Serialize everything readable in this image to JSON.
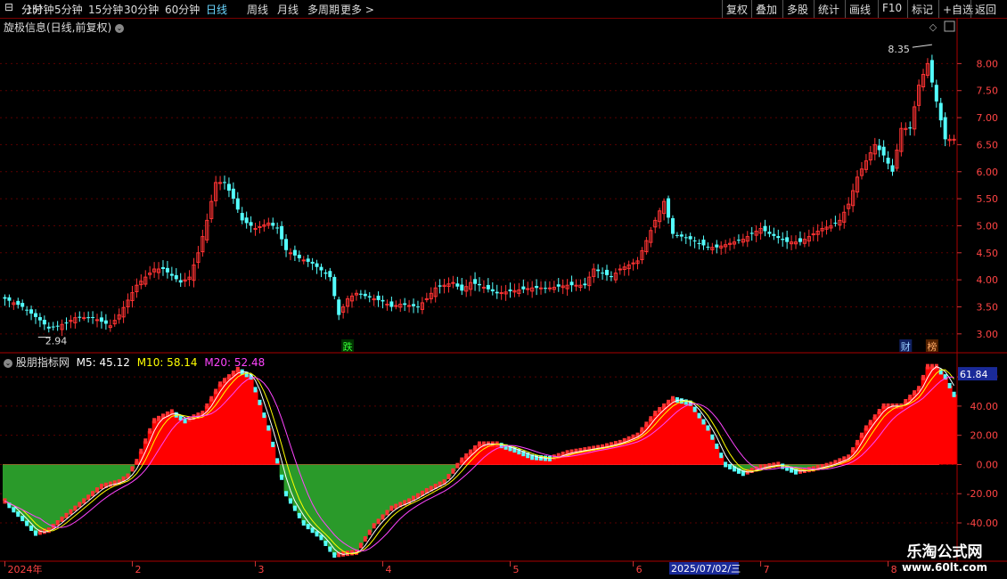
{
  "toolbar": {
    "left": [
      {
        "label": "分时",
        "active": false
      },
      {
        "label": "1分钟",
        "active": false
      },
      {
        "label": "5分钟",
        "active": false
      },
      {
        "label": "15分钟",
        "active": false
      },
      {
        "label": "30分钟",
        "active": false
      },
      {
        "label": "60分钟",
        "active": false
      },
      {
        "label": "日线",
        "active": true
      },
      {
        "label": "周线",
        "active": false
      },
      {
        "label": "月线",
        "active": false
      },
      {
        "label": "多周期",
        "active": false
      },
      {
        "label": "更多 >",
        "active": false
      }
    ],
    "right": [
      "复权",
      "叠加",
      "多股",
      "统计",
      "画线",
      "F10",
      "标记",
      "+自选",
      "返回"
    ]
  },
  "price_panel": {
    "title": "旋极信息(日线,前复权)"
  },
  "indicator_panel": {
    "name": "股朋指标网",
    "m5_label": "M5: 45.12",
    "m10_label": "M10: 58.14",
    "m20_label": "M20: 52.48",
    "current_value": "61.84"
  },
  "markers": {
    "die": "跌",
    "cai": "财",
    "bang": "榜"
  },
  "annotations": {
    "high": "8.35",
    "low": "2.94"
  },
  "date_tooltip": "2025/07/02/三",
  "watermark": {
    "line1": "乐淘公式网",
    "line2": "www.60lt.com"
  },
  "colors": {
    "up": "#ff3333",
    "down": "#54ffff",
    "zero": "#00aa00",
    "m5": "#ffffff",
    "m10": "#ffff00",
    "m20": "#ff44ff",
    "area_pos": "#ff0000",
    "area_neg": "#2a9a2a"
  },
  "chart_data": [
    {
      "type": "candlestick",
      "title": "旋极信息(日线,前复权)",
      "y_ticks": [
        3.0,
        3.5,
        4.0,
        4.5,
        5.0,
        5.5,
        6.0,
        6.5,
        7.0,
        7.5,
        8.0
      ],
      "ylim": [
        2.75,
        8.55
      ],
      "x_labels": [
        "2024年",
        "2",
        "3",
        "4",
        "5",
        "6",
        "7",
        "8"
      ],
      "close_path": [
        [
          0,
          3.65
        ],
        [
          4,
          3.5
        ],
        [
          8,
          3.25
        ],
        [
          10,
          3.1
        ],
        [
          12,
          3.15
        ],
        [
          14,
          3.2
        ],
        [
          16,
          3.3
        ],
        [
          20,
          3.3
        ],
        [
          24,
          3.15
        ],
        [
          26,
          3.35
        ],
        [
          30,
          3.9
        ],
        [
          34,
          4.2
        ],
        [
          36,
          4.2
        ],
        [
          40,
          3.95
        ],
        [
          42,
          4.05
        ],
        [
          44,
          4.5
        ],
        [
          46,
          5.1
        ],
        [
          48,
          5.8
        ],
        [
          50,
          5.8
        ],
        [
          52,
          5.5
        ],
        [
          54,
          5.1
        ],
        [
          57,
          4.95
        ],
        [
          60,
          5.05
        ],
        [
          62,
          4.95
        ],
        [
          64,
          4.55
        ],
        [
          67,
          4.4
        ],
        [
          70,
          4.3
        ],
        [
          74,
          4.05
        ],
        [
          76,
          3.35
        ],
        [
          78,
          3.65
        ],
        [
          80,
          3.75
        ],
        [
          82,
          3.7
        ],
        [
          86,
          3.6
        ],
        [
          88,
          3.5
        ],
        [
          90,
          3.55
        ],
        [
          94,
          3.5
        ],
        [
          96,
          3.65
        ],
        [
          98,
          3.85
        ],
        [
          102,
          3.95
        ],
        [
          104,
          3.8
        ],
        [
          106,
          3.95
        ],
        [
          108,
          3.9
        ],
        [
          112,
          3.75
        ],
        [
          116,
          3.8
        ],
        [
          120,
          3.85
        ],
        [
          124,
          3.85
        ],
        [
          128,
          3.9
        ],
        [
          132,
          3.9
        ],
        [
          134,
          4.2
        ],
        [
          138,
          4.05
        ],
        [
          140,
          4.2
        ],
        [
          144,
          4.35
        ],
        [
          148,
          5.1
        ],
        [
          150,
          5.45
        ],
        [
          152,
          4.85
        ],
        [
          156,
          4.75
        ],
        [
          160,
          4.6
        ],
        [
          162,
          4.6
        ],
        [
          164,
          4.65
        ],
        [
          168,
          4.75
        ],
        [
          170,
          4.85
        ],
        [
          172,
          4.95
        ],
        [
          174,
          4.85
        ],
        [
          178,
          4.7
        ],
        [
          181,
          4.7
        ],
        [
          183,
          4.8
        ],
        [
          186,
          4.95
        ],
        [
          188,
          5.0
        ],
        [
          190,
          5.1
        ],
        [
          192,
          5.4
        ],
        [
          194,
          5.9
        ],
        [
          196,
          6.2
        ],
        [
          198,
          6.5
        ],
        [
          200,
          6.3
        ],
        [
          202,
          6.0
        ],
        [
          204,
          6.8
        ],
        [
          206,
          6.8
        ],
        [
          208,
          7.6
        ],
        [
          210,
          8.0
        ],
        [
          212,
          7.3
        ],
        [
          214,
          6.6
        ],
        [
          216,
          6.6
        ]
      ],
      "annotations": [
        {
          "text": "8.35",
          "x": 211,
          "y": 8.35
        },
        {
          "text": "2.94",
          "x": 10,
          "y": 2.94
        }
      ]
    },
    {
      "type": "area",
      "title": "股朋指标网",
      "y_ticks": [
        -40,
        -20,
        0,
        20,
        40,
        60
      ],
      "ylim": [
        -65,
        68
      ],
      "main_path": [
        [
          0,
          -25
        ],
        [
          4,
          -37
        ],
        [
          7,
          -47
        ],
        [
          10,
          -45
        ],
        [
          14,
          -35
        ],
        [
          18,
          -25
        ],
        [
          22,
          -15
        ],
        [
          26,
          -12
        ],
        [
          28,
          -8
        ],
        [
          30,
          2
        ],
        [
          34,
          30
        ],
        [
          38,
          36
        ],
        [
          41,
          30
        ],
        [
          45,
          35
        ],
        [
          49,
          55
        ],
        [
          53,
          65
        ],
        [
          56,
          60
        ],
        [
          60,
          25
        ],
        [
          64,
          -20
        ],
        [
          68,
          -40
        ],
        [
          72,
          -50
        ],
        [
          75,
          -62
        ],
        [
          80,
          -60
        ],
        [
          84,
          -42
        ],
        [
          88,
          -30
        ],
        [
          92,
          -25
        ],
        [
          96,
          -18
        ],
        [
          100,
          -12
        ],
        [
          104,
          3
        ],
        [
          108,
          14
        ],
        [
          112,
          14
        ],
        [
          116,
          10
        ],
        [
          120,
          5
        ],
        [
          124,
          4
        ],
        [
          128,
          8
        ],
        [
          132,
          10
        ],
        [
          136,
          12
        ],
        [
          140,
          15
        ],
        [
          144,
          20
        ],
        [
          148,
          35
        ],
        [
          152,
          45
        ],
        [
          156,
          42
        ],
        [
          160,
          25
        ],
        [
          164,
          0
        ],
        [
          168,
          -6
        ],
        [
          172,
          -2
        ],
        [
          176,
          0
        ],
        [
          180,
          -5
        ],
        [
          184,
          -3
        ],
        [
          188,
          0
        ],
        [
          192,
          5
        ],
        [
          196,
          25
        ],
        [
          200,
          40
        ],
        [
          204,
          40
        ],
        [
          208,
          52
        ],
        [
          210,
          67
        ],
        [
          212,
          67
        ],
        [
          214,
          60
        ],
        [
          216,
          48
        ]
      ],
      "series": [
        {
          "name": "M5",
          "value": 45.12
        },
        {
          "name": "M10",
          "value": 58.14
        },
        {
          "name": "M20",
          "value": 52.48
        }
      ]
    }
  ]
}
